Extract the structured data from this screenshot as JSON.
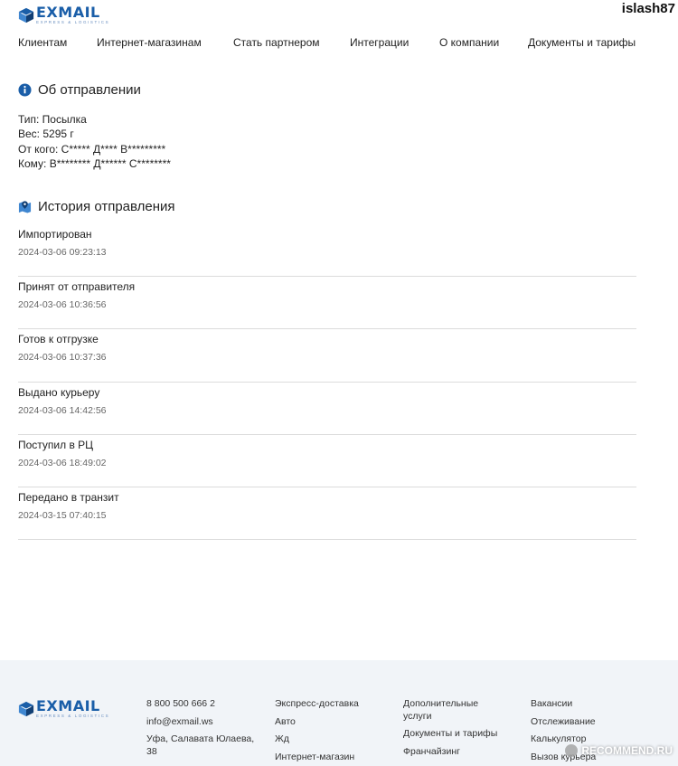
{
  "header": {
    "logo_text": "EXMAIL",
    "logo_tagline": "EXPRESS & LOGISTICS",
    "username": "islash87"
  },
  "nav": {
    "items": [
      {
        "label": "Клиентам"
      },
      {
        "label": "Интернет-магазинам"
      },
      {
        "label": "Стать партнером"
      },
      {
        "label": "Интеграции"
      },
      {
        "label": "О компании"
      },
      {
        "label": "Документы и тарифы"
      }
    ]
  },
  "shipment": {
    "title": "Об отправлении",
    "type": "Тип: Посылка",
    "weight": "Вес: 5295 г",
    "from": "От кого: С***** Д**** В*********",
    "to": "Кому: В******** Д****** С********"
  },
  "history": {
    "title": "История отправления",
    "events": [
      {
        "status": "Импортирован",
        "time": "2024-03-06 09:23:13"
      },
      {
        "status": "Принят от отправителя",
        "time": "2024-03-06 10:36:56"
      },
      {
        "status": "Готов к отгрузке",
        "time": "2024-03-06 10:37:36"
      },
      {
        "status": "Выдано курьеру",
        "time": "2024-03-06 14:42:56"
      },
      {
        "status": "Поступил в РЦ",
        "time": "2024-03-06 18:49:02"
      },
      {
        "status": "Передано в транзит",
        "time": "2024-03-15 07:40:15"
      }
    ]
  },
  "footer": {
    "contacts": {
      "phone": "8 800 500 666 2",
      "email": "info@exmail.ws",
      "address": "Уфа, Салавата Юлаева, 38"
    },
    "col2": [
      "Экспресс-доставка",
      "Авто",
      "Жд",
      "Интернет-магазин"
    ],
    "col3": [
      "Дополнительные услуги",
      "Документы и тарифы",
      "Франчайзинг"
    ],
    "col4": [
      "Вакансии",
      "Отслеживание",
      "Калькулятор",
      "Вызов курьера"
    ]
  },
  "watermark": "RECOMMEND.RU",
  "colors": {
    "brand": "#1a5ea8",
    "divider": "#dcdcdc",
    "footer_bg": "#f1f4f8"
  }
}
